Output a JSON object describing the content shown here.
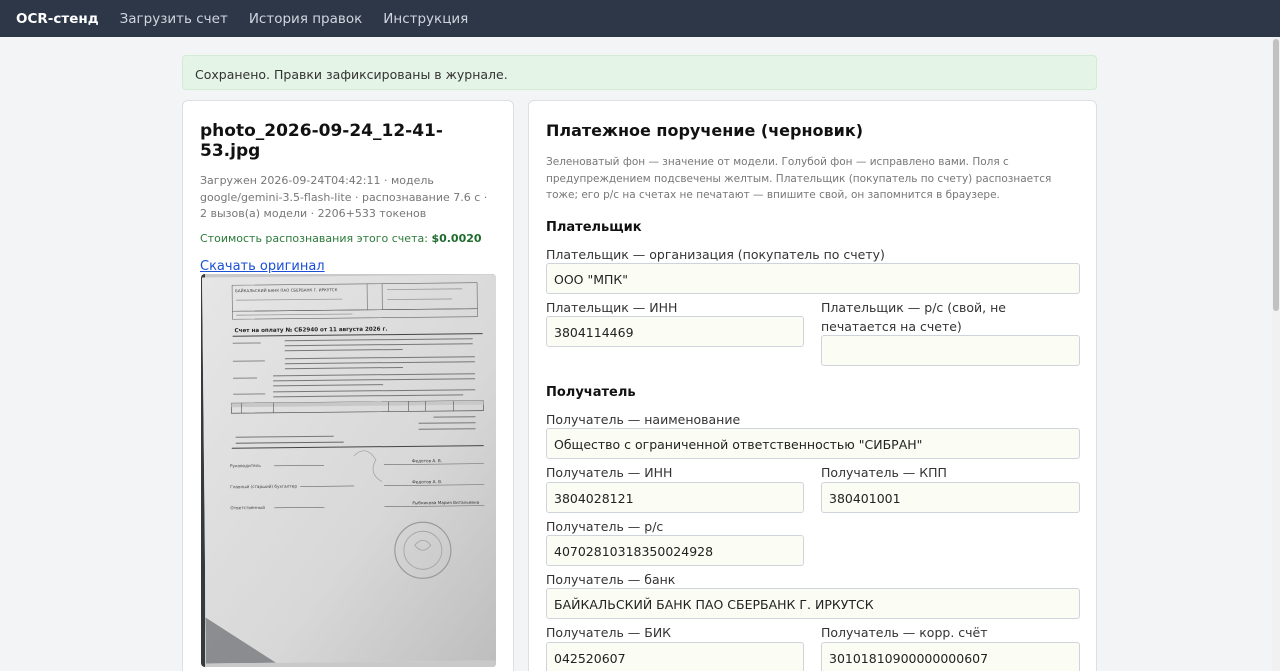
{
  "nav": {
    "brand": "OCR-стенд",
    "links": [
      "Загрузить счет",
      "История правок",
      "Инструкция"
    ]
  },
  "alert": {
    "text": "Сохранено. Правки зафиксированы в журнале."
  },
  "file": {
    "name": "photo_2026-09-24_12-41-53.jpg",
    "meta": "Загружен 2026-09-24T04:42:11 · модель google/gemini-3.5-flash-lite · распознавание 7.6 с · 2 вызов(а) модели · 2206+533 токенов",
    "cost_label": "Стоимость распознавания этого счета:",
    "cost_value": "$0.0020",
    "download_label": "Скачать оригинал",
    "photo": {
      "title": "Счет на оплату № СБ2940 от 11 августа 2026 г.",
      "bank": "БАЙКАЛЬСКИЙ БАНК ПАО СБЕРБАНК Г. ИРКУТСК",
      "roles": [
        "Руководитель",
        "Главный (старший) бухгалтер",
        "Ответственный"
      ],
      "signers": [
        "Федотов А. В.",
        "Федотов А. В.",
        "Рыбникова Мария Витальевна"
      ]
    }
  },
  "form": {
    "title": "Платежное поручение (черновик)",
    "hint": "Зеленоватый фон — значение от модели. Голубой фон — исправлено вами. Поля с предупреждением подсвечены желтым. Плательщик (покупатель по счету) распознается тоже; его р/с на счетах не печатают — впишите свой, он запомнится в браузере.",
    "payer": {
      "heading": "Плательщик",
      "org_label": "Плательщик — организация (покупатель по счету)",
      "org_value": "ООО \"МПК\"",
      "inn_label": "Плательщик — ИНН",
      "inn_value": "3804114469",
      "account_label": "Плательщик — р/с (свой, не печатается на счете)",
      "account_value": ""
    },
    "recipient": {
      "heading": "Получатель",
      "name_label": "Получатель — наименование",
      "name_value": "Общество с ограниченной ответственностью \"СИБРАН\"",
      "inn_label": "Получатель — ИНН",
      "inn_value": "3804028121",
      "kpp_label": "Получатель — КПП",
      "kpp_value": "380401001",
      "account_label": "Получатель — р/с",
      "account_value": "40702810318350024928",
      "bank_label": "Получатель — банк",
      "bank_value": "БАЙКАЛЬСКИЙ БАНК ПАО СБЕРБАНК Г. ИРКУТСК",
      "bik_label": "Получатель — БИК",
      "bik_value": "042520607",
      "corr_label": "Получатель — корр. счёт",
      "corr_value": "30101810900000000607"
    }
  },
  "colors": {
    "navbar": "#2d3748",
    "alert_bg": "#e4f4e6",
    "model_field_bg": "#fbfdf4",
    "link": "#1a4fd6",
    "cost": "#2c7a3a"
  }
}
